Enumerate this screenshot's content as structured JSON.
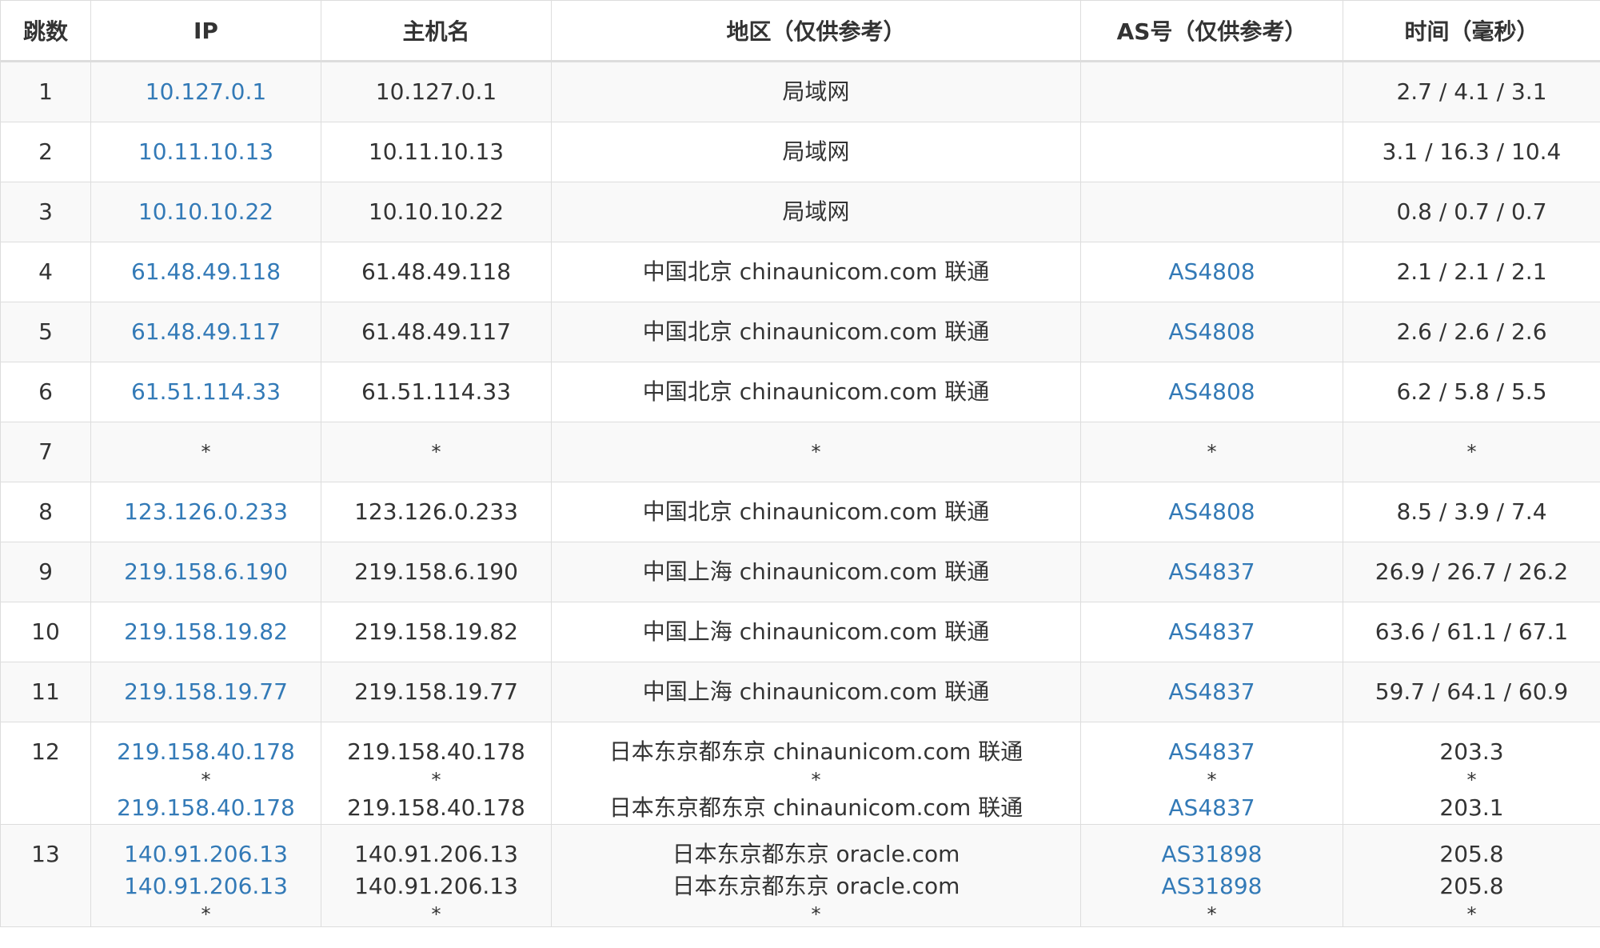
{
  "columns": [
    "跳数",
    "IP",
    "主机名",
    "地区（仅供参考）",
    "AS号（仅供参考）",
    "时间（毫秒）"
  ],
  "hops": [
    {
      "hop": "1",
      "ip": [
        "10.127.0.1"
      ],
      "host": [
        "10.127.0.1"
      ],
      "region": [
        "局域网"
      ],
      "as": [
        ""
      ],
      "time": [
        "2.7 / 4.1 / 3.1"
      ]
    },
    {
      "hop": "2",
      "ip": [
        "10.11.10.13"
      ],
      "host": [
        "10.11.10.13"
      ],
      "region": [
        "局域网"
      ],
      "as": [
        ""
      ],
      "time": [
        "3.1 / 16.3 / 10.4"
      ]
    },
    {
      "hop": "3",
      "ip": [
        "10.10.10.22"
      ],
      "host": [
        "10.10.10.22"
      ],
      "region": [
        "局域网"
      ],
      "as": [
        ""
      ],
      "time": [
        "0.8 / 0.7 / 0.7"
      ]
    },
    {
      "hop": "4",
      "ip": [
        "61.48.49.118"
      ],
      "host": [
        "61.48.49.118"
      ],
      "region": [
        "中国北京 chinaunicom.com 联通"
      ],
      "as": [
        "AS4808"
      ],
      "time": [
        "2.1 / 2.1 / 2.1"
      ]
    },
    {
      "hop": "5",
      "ip": [
        "61.48.49.117"
      ],
      "host": [
        "61.48.49.117"
      ],
      "region": [
        "中国北京 chinaunicom.com 联通"
      ],
      "as": [
        "AS4808"
      ],
      "time": [
        "2.6 / 2.6 / 2.6"
      ]
    },
    {
      "hop": "6",
      "ip": [
        "61.51.114.33"
      ],
      "host": [
        "61.51.114.33"
      ],
      "region": [
        "中国北京 chinaunicom.com 联通"
      ],
      "as": [
        "AS4808"
      ],
      "time": [
        "6.2 / 5.8 / 5.5"
      ]
    },
    {
      "hop": "7",
      "ip": [
        "*"
      ],
      "host": [
        "*"
      ],
      "region": [
        "*"
      ],
      "as": [
        "*"
      ],
      "time": [
        "*"
      ]
    },
    {
      "hop": "8",
      "ip": [
        "123.126.0.233"
      ],
      "host": [
        "123.126.0.233"
      ],
      "region": [
        "中国北京 chinaunicom.com 联通"
      ],
      "as": [
        "AS4808"
      ],
      "time": [
        "8.5 / 3.9 / 7.4"
      ]
    },
    {
      "hop": "9",
      "ip": [
        "219.158.6.190"
      ],
      "host": [
        "219.158.6.190"
      ],
      "region": [
        "中国上海 chinaunicom.com 联通"
      ],
      "as": [
        "AS4837"
      ],
      "time": [
        "26.9 / 26.7 / 26.2"
      ]
    },
    {
      "hop": "10",
      "ip": [
        "219.158.19.82"
      ],
      "host": [
        "219.158.19.82"
      ],
      "region": [
        "中国上海 chinaunicom.com 联通"
      ],
      "as": [
        "AS4837"
      ],
      "time": [
        "63.6 / 61.1 / 67.1"
      ]
    },
    {
      "hop": "11",
      "ip": [
        "219.158.19.77"
      ],
      "host": [
        "219.158.19.77"
      ],
      "region": [
        "中国上海 chinaunicom.com 联通"
      ],
      "as": [
        "AS4837"
      ],
      "time": [
        "59.7 / 64.1 / 60.9"
      ]
    },
    {
      "hop": "12",
      "ip": [
        "219.158.40.178",
        "*",
        "219.158.40.178"
      ],
      "host": [
        "219.158.40.178",
        "*",
        "219.158.40.178"
      ],
      "region": [
        "日本东京都东京 chinaunicom.com 联通",
        "*",
        "日本东京都东京 chinaunicom.com 联通"
      ],
      "as": [
        "AS4837",
        "*",
        "AS4837"
      ],
      "time": [
        "203.3",
        "*",
        "203.1"
      ]
    },
    {
      "hop": "13",
      "ip": [
        "140.91.206.13",
        "140.91.206.13",
        "*"
      ],
      "host": [
        "140.91.206.13",
        "140.91.206.13",
        "*"
      ],
      "region": [
        "日本东京都东京 oracle.com",
        "日本东京都东京 oracle.com",
        "*"
      ],
      "as": [
        "AS31898",
        "AS31898",
        "*"
      ],
      "time": [
        "205.8",
        "205.8",
        "*"
      ]
    }
  ],
  "colors": {
    "link": "#337ab7",
    "text": "#333333",
    "border": "#dddddd",
    "stripe": "#f9f9f9"
  }
}
